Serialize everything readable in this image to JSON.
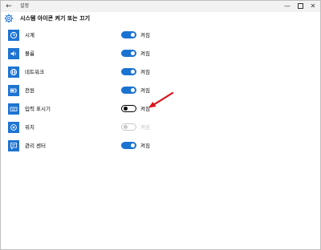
{
  "window": {
    "title": "설정",
    "back_icon": "back-arrow-icon",
    "minimize_glyph": "—",
    "close_glyph": "✕"
  },
  "header": {
    "title": "시스템 아이콘 켜기 또는 끄기",
    "icon": "gear-icon"
  },
  "rows": [
    {
      "label": "시계",
      "icon": "clock-icon",
      "state": "on",
      "status": "켜짐"
    },
    {
      "label": "볼륨",
      "icon": "volume-icon",
      "state": "on",
      "status": "켜짐"
    },
    {
      "label": "네트워크",
      "icon": "network-icon",
      "state": "on",
      "status": "켜짐"
    },
    {
      "label": "전원",
      "icon": "battery-icon",
      "state": "on",
      "status": "켜짐"
    },
    {
      "label": "입력 표시기",
      "icon": "keyboard-icon",
      "state": "off",
      "status": "켜짐"
    },
    {
      "label": "위치",
      "icon": "location-icon",
      "state": "disabled",
      "status": "켜짐"
    },
    {
      "label": "관리 센터",
      "icon": "action-center-icon",
      "state": "on",
      "status": "켜짐"
    }
  ],
  "colors": {
    "accent": "#1b73d1",
    "icon_tile": "#1e74d2",
    "annotation_arrow": "#d9141b"
  }
}
